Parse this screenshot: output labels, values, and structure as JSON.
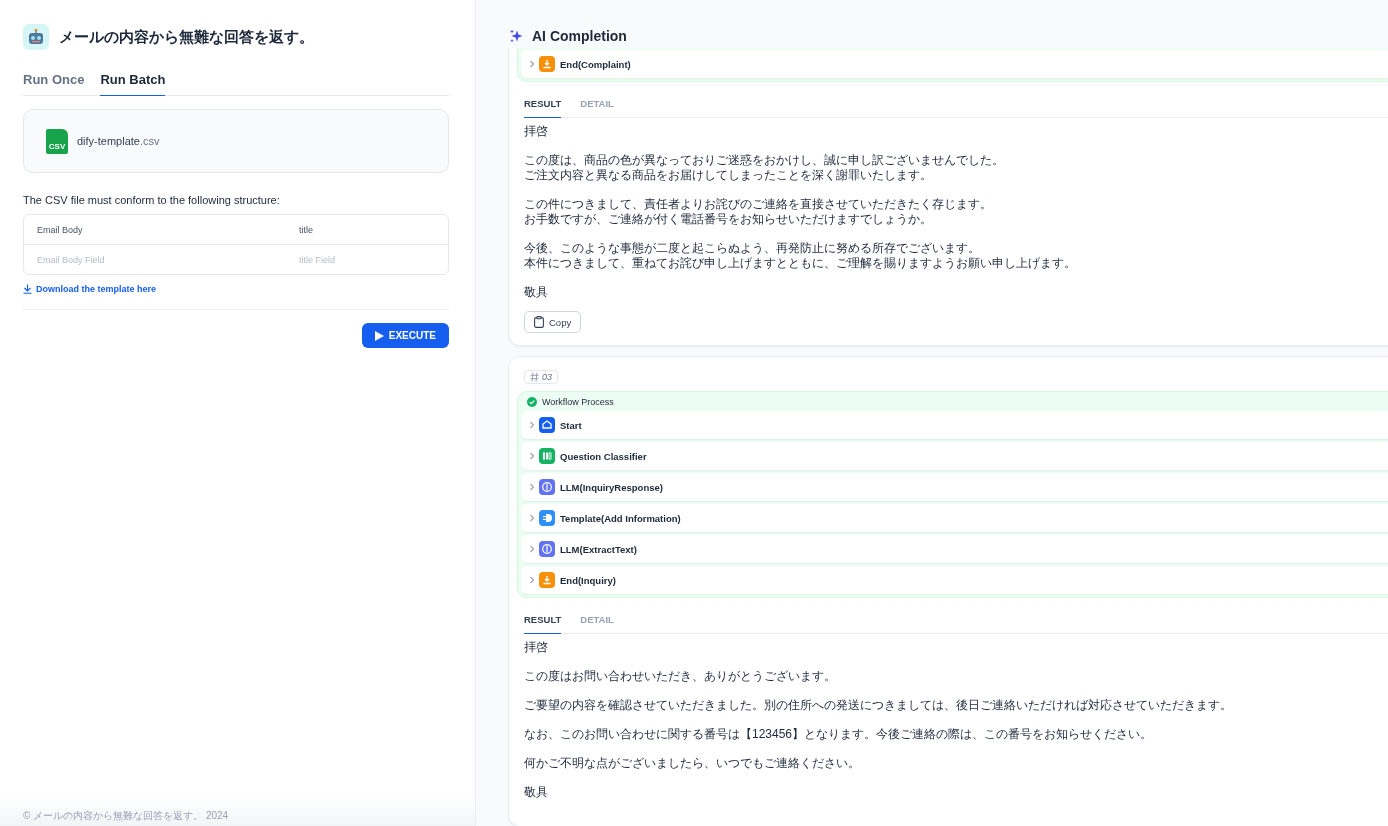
{
  "app": {
    "title": "メールの内容から無難な回答を返す。"
  },
  "mode_tabs": [
    {
      "label": "Run Once",
      "selected": false
    },
    {
      "label": "Run Batch",
      "selected": true
    }
  ],
  "file": {
    "name": "dify-template",
    "extension": ".csv",
    "badge": "CSV"
  },
  "structure_note": "The CSV file must conform to the following structure:",
  "structure_table": {
    "columns": [
      "Email Body",
      "title"
    ],
    "rows": [
      [
        "Email Body Field",
        "title Field"
      ]
    ]
  },
  "download_link": "Download the template here",
  "execute_button": "EXECUTE",
  "footer": "© メールの内容から無難な回答を返す。 2024",
  "result_panel": {
    "title": "AI Completion",
    "results": [
      {
        "workflow": {
          "nodes": [
            {
              "label": "End(Complaint)",
              "kind": "end",
              "expanded": false
            }
          ]
        },
        "tabs": [
          {
            "label": "RESULT",
            "selected": true
          },
          {
            "label": "DETAIL",
            "selected": false
          }
        ],
        "paragraphs": [
          [
            "拝啓"
          ],
          [
            "この度は、商品の色が異なっておりご迷惑をおかけし、誠に申し訳ございませんでした。",
            "ご注文内容と異なる商品をお届けしてしまったことを深く謝罪いたします。"
          ],
          [
            "この件につきまして、責任者よりお詫びのご連絡を直接させていただきたく存じます。",
            "お手数ですが、ご連絡が付く電話番号をお知らせいただけますでしょうか。"
          ],
          [
            "今後、このような事態が二度と起こらぬよう、再発防止に努める所存でございます。",
            "本件につきまして、重ねてお詫び申し上げますとともに、ご理解を賜りますようお願い申し上げます。"
          ],
          [
            "敬具"
          ]
        ],
        "copy_button": "Copy"
      },
      {
        "index": "03",
        "workflow": {
          "title": "Workflow Process",
          "nodes": [
            {
              "label": "Start",
              "kind": "start",
              "expanded": false
            },
            {
              "label": "Question Classifier",
              "kind": "classifier",
              "expanded": false
            },
            {
              "label": "LLM(InquiryResponse)",
              "kind": "llm",
              "expanded": false
            },
            {
              "label": "Template(Add Information)",
              "kind": "template",
              "expanded": false
            },
            {
              "label": "LLM(ExtractText)",
              "kind": "llm",
              "expanded": false
            },
            {
              "label": "End(Inquiry)",
              "kind": "end",
              "expanded": false
            }
          ]
        },
        "tabs": [
          {
            "label": "RESULT",
            "selected": true
          },
          {
            "label": "DETAIL",
            "selected": false
          }
        ],
        "paragraphs": [
          [
            "拝啓"
          ],
          [
            "この度はお問い合わせいただき、ありがとうございます。"
          ],
          [
            "ご要望の内容を確認させていただきました。別の住所への発送につきましては、後日ご連絡いただければ対応させていただきます。"
          ],
          [
            "なお、このお問い合わせに関する番号は【123456】となります。今後ご連絡の際は、この番号をお知らせください。"
          ],
          [
            "何かご不明な点がございましたら、いつでもご連絡ください。"
          ],
          [
            "敬具"
          ]
        ]
      }
    ]
  }
}
